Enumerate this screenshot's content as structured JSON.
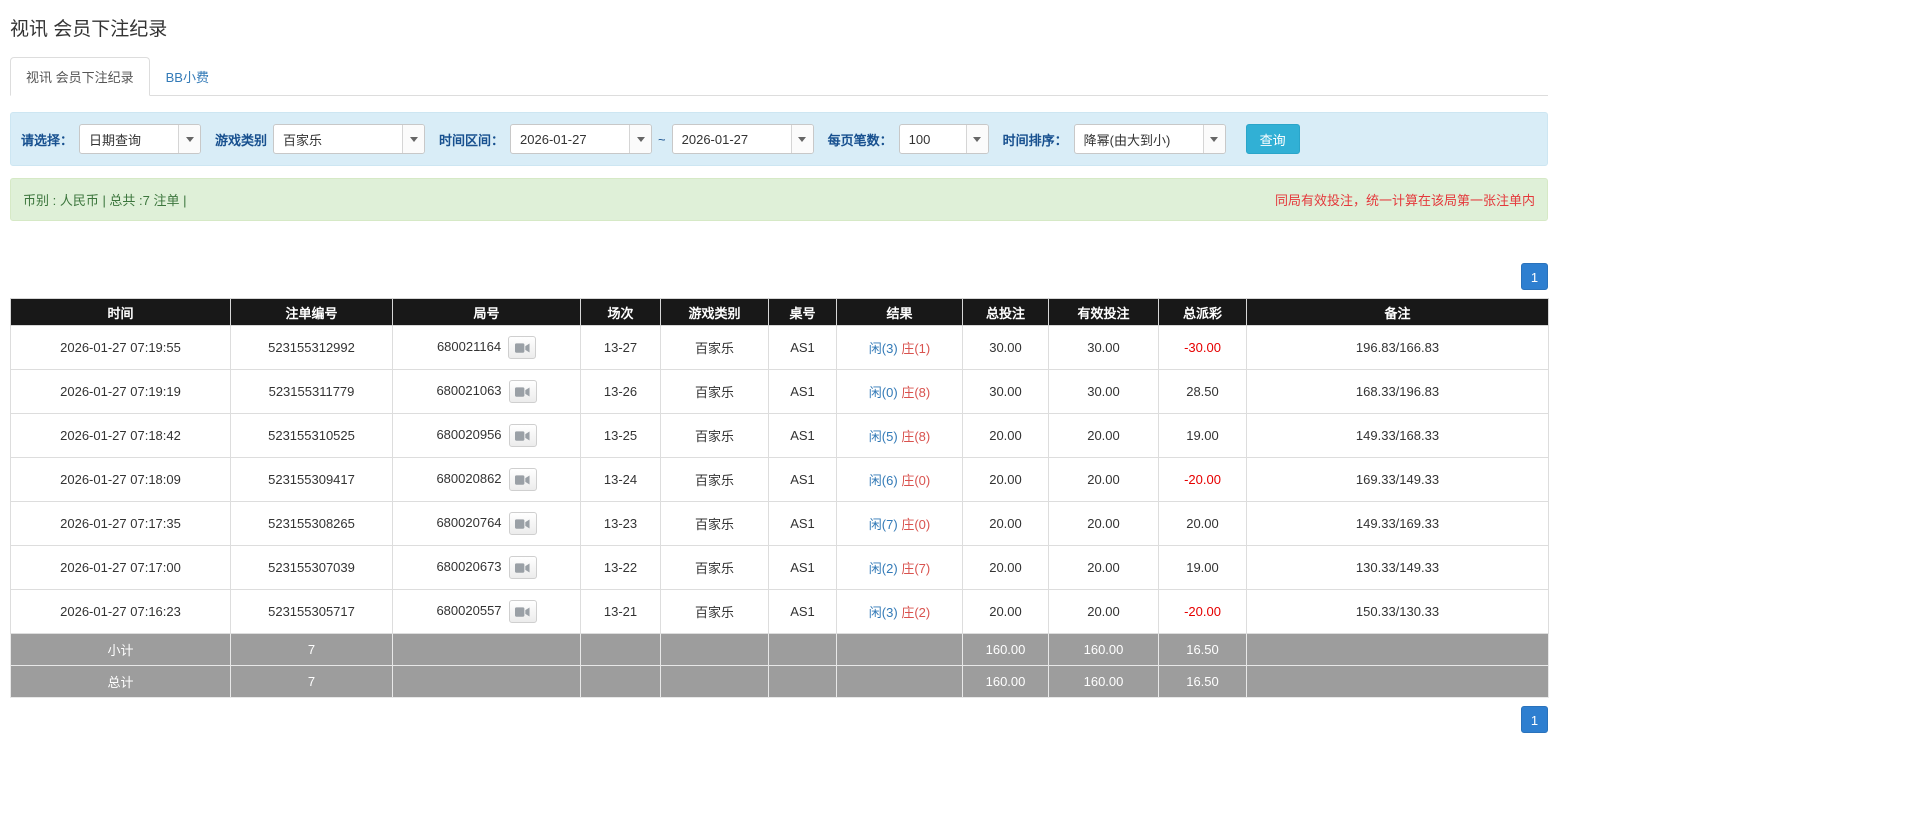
{
  "page": {
    "title": "视讯 会员下注纪录"
  },
  "tabs": {
    "records": {
      "label": "视讯 会员下注纪录"
    },
    "tips": {
      "label": "BB小费"
    }
  },
  "filters": {
    "select_label": "请选择：",
    "select_value": "日期查询",
    "game_type_label": "游戏类别",
    "game_type_value": "百家乐",
    "date_range_label": "时间区间：",
    "date_from": "2026-01-27",
    "date_separator": "~",
    "date_to": "2026-01-27",
    "page_size_label": "每页笔数：",
    "page_size_value": "100",
    "sort_label": "时间排序：",
    "sort_value": "降幂(由大到小)",
    "search_button_label": "查询"
  },
  "summary": {
    "left_text": "币别 : 人民币 | 总共 :7 注单 |",
    "right_note": "同局有效投注，统一计算在该局第一张注单内"
  },
  "pagination": {
    "current_page": "1"
  },
  "colors": {
    "accent_blue": "#337ab7",
    "banker_red": "#d9534f",
    "negative_red": "#e60000",
    "filter_bg": "#d9edf7",
    "summary_bg": "#dff0d8",
    "header_bg": "#181818",
    "totals_bg": "#9d9d9d",
    "search_button_bg": "#31b0d5"
  },
  "table": {
    "headers": [
      "时间",
      "注单编号",
      "局号",
      "场次",
      "游戏类别",
      "桌号",
      "结果",
      "总投注",
      "有效投注",
      "总派彩",
      "备注"
    ],
    "rows": [
      {
        "time": "2026-01-27 07:19:55",
        "bet_id": "523155312992",
        "round": "680021164",
        "session": "13-27",
        "game": "百家乐",
        "table_no": "AS1",
        "result_player": "闲(3)",
        "result_banker": "庄(1)",
        "total_bet": "30.00",
        "valid_bet": "30.00",
        "payout": "-30.00",
        "remark": "196.83/166.83"
      },
      {
        "time": "2026-01-27 07:19:19",
        "bet_id": "523155311779",
        "round": "680021063",
        "session": "13-26",
        "game": "百家乐",
        "table_no": "AS1",
        "result_player": "闲(0)",
        "result_banker": "庄(8)",
        "total_bet": "30.00",
        "valid_bet": "30.00",
        "payout": "28.50",
        "remark": "168.33/196.83"
      },
      {
        "time": "2026-01-27 07:18:42",
        "bet_id": "523155310525",
        "round": "680020956",
        "session": "13-25",
        "game": "百家乐",
        "table_no": "AS1",
        "result_player": "闲(5)",
        "result_banker": "庄(8)",
        "total_bet": "20.00",
        "valid_bet": "20.00",
        "payout": "19.00",
        "remark": "149.33/168.33"
      },
      {
        "time": "2026-01-27 07:18:09",
        "bet_id": "523155309417",
        "round": "680020862",
        "session": "13-24",
        "game": "百家乐",
        "table_no": "AS1",
        "result_player": "闲(6)",
        "result_banker": "庄(0)",
        "total_bet": "20.00",
        "valid_bet": "20.00",
        "payout": "-20.00",
        "remark": "169.33/149.33"
      },
      {
        "time": "2026-01-27 07:17:35",
        "bet_id": "523155308265",
        "round": "680020764",
        "session": "13-23",
        "game": "百家乐",
        "table_no": "AS1",
        "result_player": "闲(7)",
        "result_banker": "庄(0)",
        "total_bet": "20.00",
        "valid_bet": "20.00",
        "payout": "20.00",
        "remark": "149.33/169.33"
      },
      {
        "time": "2026-01-27 07:17:00",
        "bet_id": "523155307039",
        "round": "680020673",
        "session": "13-22",
        "game": "百家乐",
        "table_no": "AS1",
        "result_player": "闲(2)",
        "result_banker": "庄(7)",
        "total_bet": "20.00",
        "valid_bet": "20.00",
        "payout": "19.00",
        "remark": "130.33/149.33"
      },
      {
        "time": "2026-01-27 07:16:23",
        "bet_id": "523155305717",
        "round": "680020557",
        "session": "13-21",
        "game": "百家乐",
        "table_no": "AS1",
        "result_player": "闲(3)",
        "result_banker": "庄(2)",
        "total_bet": "20.00",
        "valid_bet": "20.00",
        "payout": "-20.00",
        "remark": "150.33/130.33"
      }
    ],
    "subtotal": {
      "label": "小计",
      "count": "7",
      "total_bet": "160.00",
      "valid_bet": "160.00",
      "payout": "16.50"
    },
    "total": {
      "label": "总计",
      "count": "7",
      "total_bet": "160.00",
      "valid_bet": "160.00",
      "payout": "16.50"
    }
  }
}
